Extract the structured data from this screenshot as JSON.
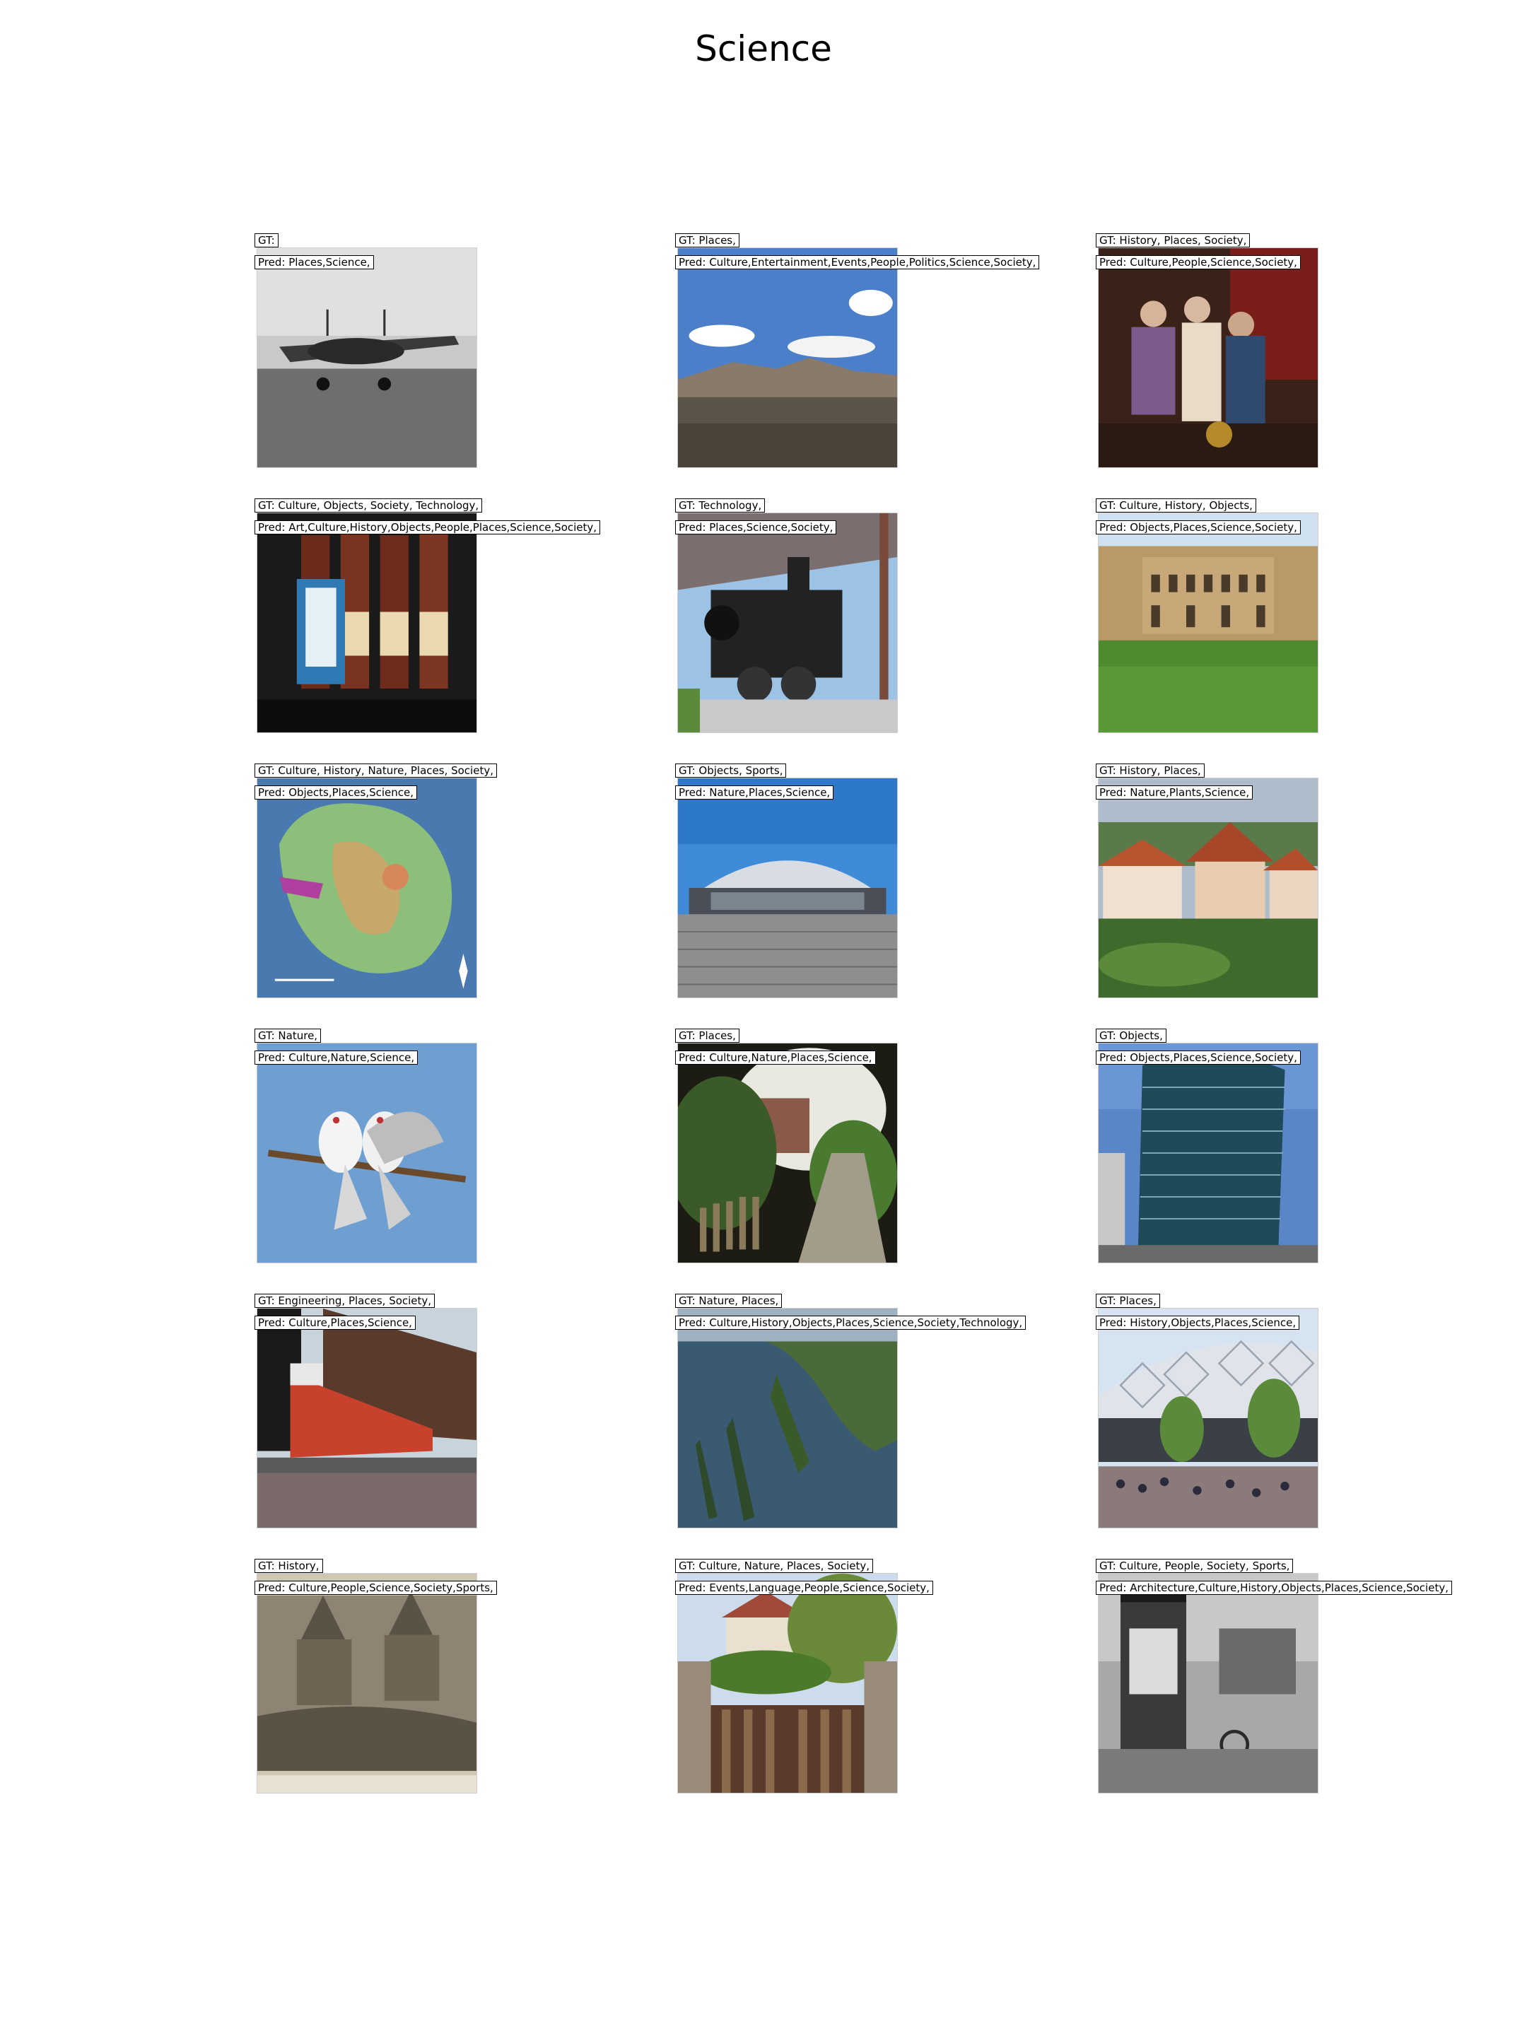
{
  "figure": {
    "title": "Science"
  },
  "samples": [
    {
      "gt": "GT: ",
      "pred": "Pred: Places,Science,",
      "scene": "airplane"
    },
    {
      "gt": "GT: Places,",
      "pred": "Pred: Culture,Entertainment,Events,People,Politics,Science,Society,",
      "scene": "desert-mountains"
    },
    {
      "gt": "GT: History, Places, Society,",
      "pred": "Pred: Culture,People,Science,Society,",
      "scene": "painting-crowd"
    },
    {
      "gt": "GT: Culture, Objects, Society, Technology,",
      "pred": "Pred: Art,Culture,History,Objects,People,Places,Science,Society,",
      "scene": "wine-bottles"
    },
    {
      "gt": "GT: Technology,",
      "pred": "Pred: Places,Science,Society,",
      "scene": "locomotive"
    },
    {
      "gt": "GT: Culture, History, Objects,",
      "pred": "Pred: Objects,Places,Science,Society,",
      "scene": "courtyard"
    },
    {
      "gt": "GT: Culture, History, Nature, Places, Society,",
      "pred": "Pred: Objects,Places,Science,",
      "scene": "island-map"
    },
    {
      "gt": "GT: Objects, Sports,",
      "pred": "Pred: Nature,Places,Science,",
      "scene": "stadium"
    },
    {
      "gt": "GT: History, Places,",
      "pred": "Pred: Nature,Plants,Science,",
      "scene": "village"
    },
    {
      "gt": "GT: Nature,",
      "pred": "Pred: Culture,Nature,Science,",
      "scene": "birds"
    },
    {
      "gt": "GT: Places,",
      "pred": "Pred: Culture,Nature,Places,Science,",
      "scene": "garden-path"
    },
    {
      "gt": "GT: Objects,",
      "pred": "Pred: Objects,Places,Science,Society,",
      "scene": "glass-tower"
    },
    {
      "gt": "GT: Engineering, Places, Society,",
      "pred": "Pred: Culture,Places,Science,",
      "scene": "ship"
    },
    {
      "gt": "GT: Nature, Places,",
      "pred": "Pred: Culture,History,Objects,Places,Science,Society,Technology,",
      "scene": "aerial-water"
    },
    {
      "gt": "GT: Places,",
      "pred": "Pred: History,Objects,Places,Science,",
      "scene": "modern-building-crowd"
    },
    {
      "gt": "GT: History,",
      "pred": "Pred: Culture,People,Science,Society,Sports,",
      "scene": "engraving"
    },
    {
      "gt": "GT: Culture, Nature, Places, Society,",
      "pred": "Pred: Events,Language,People,Science,Society,",
      "scene": "gate"
    },
    {
      "gt": "GT: Culture, People, Society, Sports,",
      "pred": "Pred: Architecture,Culture,History,Objects,Places,Science,Society,",
      "scene": "old-photo-kiosk"
    }
  ]
}
